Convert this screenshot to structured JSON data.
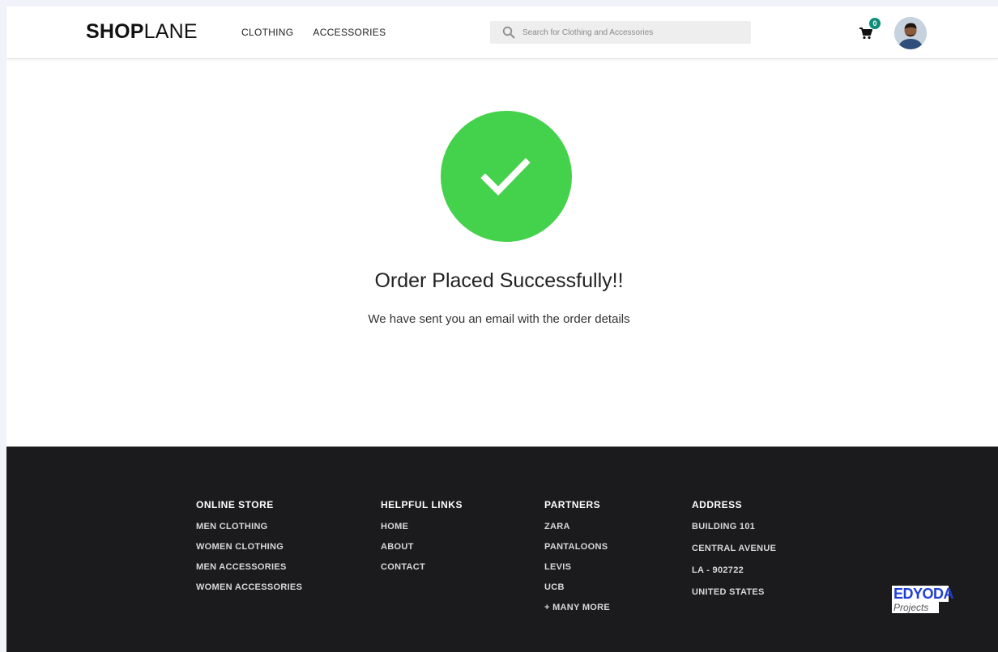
{
  "header": {
    "logo_bold": "SHOP",
    "logo_light": "LANE",
    "nav": [
      {
        "label": "CLOTHING"
      },
      {
        "label": "ACCESSORIES"
      }
    ],
    "search": {
      "placeholder": "Search for Clothing and Accessories",
      "value": ""
    },
    "cart": {
      "count": "0",
      "icon": "cart-icon",
      "badge_color": "#0f8c7a"
    },
    "avatar": {
      "icon": "user-avatar"
    }
  },
  "main": {
    "icon": "check-icon",
    "accent_color": "#44d14b",
    "title": "Order Placed Successfully!!",
    "subtitle": "We have sent you an email with the order details"
  },
  "footer": {
    "background": "#1b1b1d",
    "columns": [
      {
        "heading": "ONLINE STORE",
        "items": [
          "MEN CLOTHING",
          "WOMEN CLOTHING",
          "MEN ACCESSORIES",
          "WOMEN ACCESSORIES"
        ]
      },
      {
        "heading": "HELPFUL LINKS",
        "items": [
          "HOME",
          "ABOUT",
          "CONTACT"
        ]
      },
      {
        "heading": "PARTNERS",
        "items": [
          "ZARA",
          "PANTALOONS",
          "LEVIS",
          "UCB",
          "+ MANY MORE"
        ]
      },
      {
        "heading": "ADDRESS",
        "items": [
          "BUILDING 101",
          "CENTRAL AVENUE",
          "LA - 902722",
          "UNITED STATES"
        ]
      }
    ],
    "badge": {
      "top": "EDYODA",
      "bottom": "Projects"
    }
  }
}
